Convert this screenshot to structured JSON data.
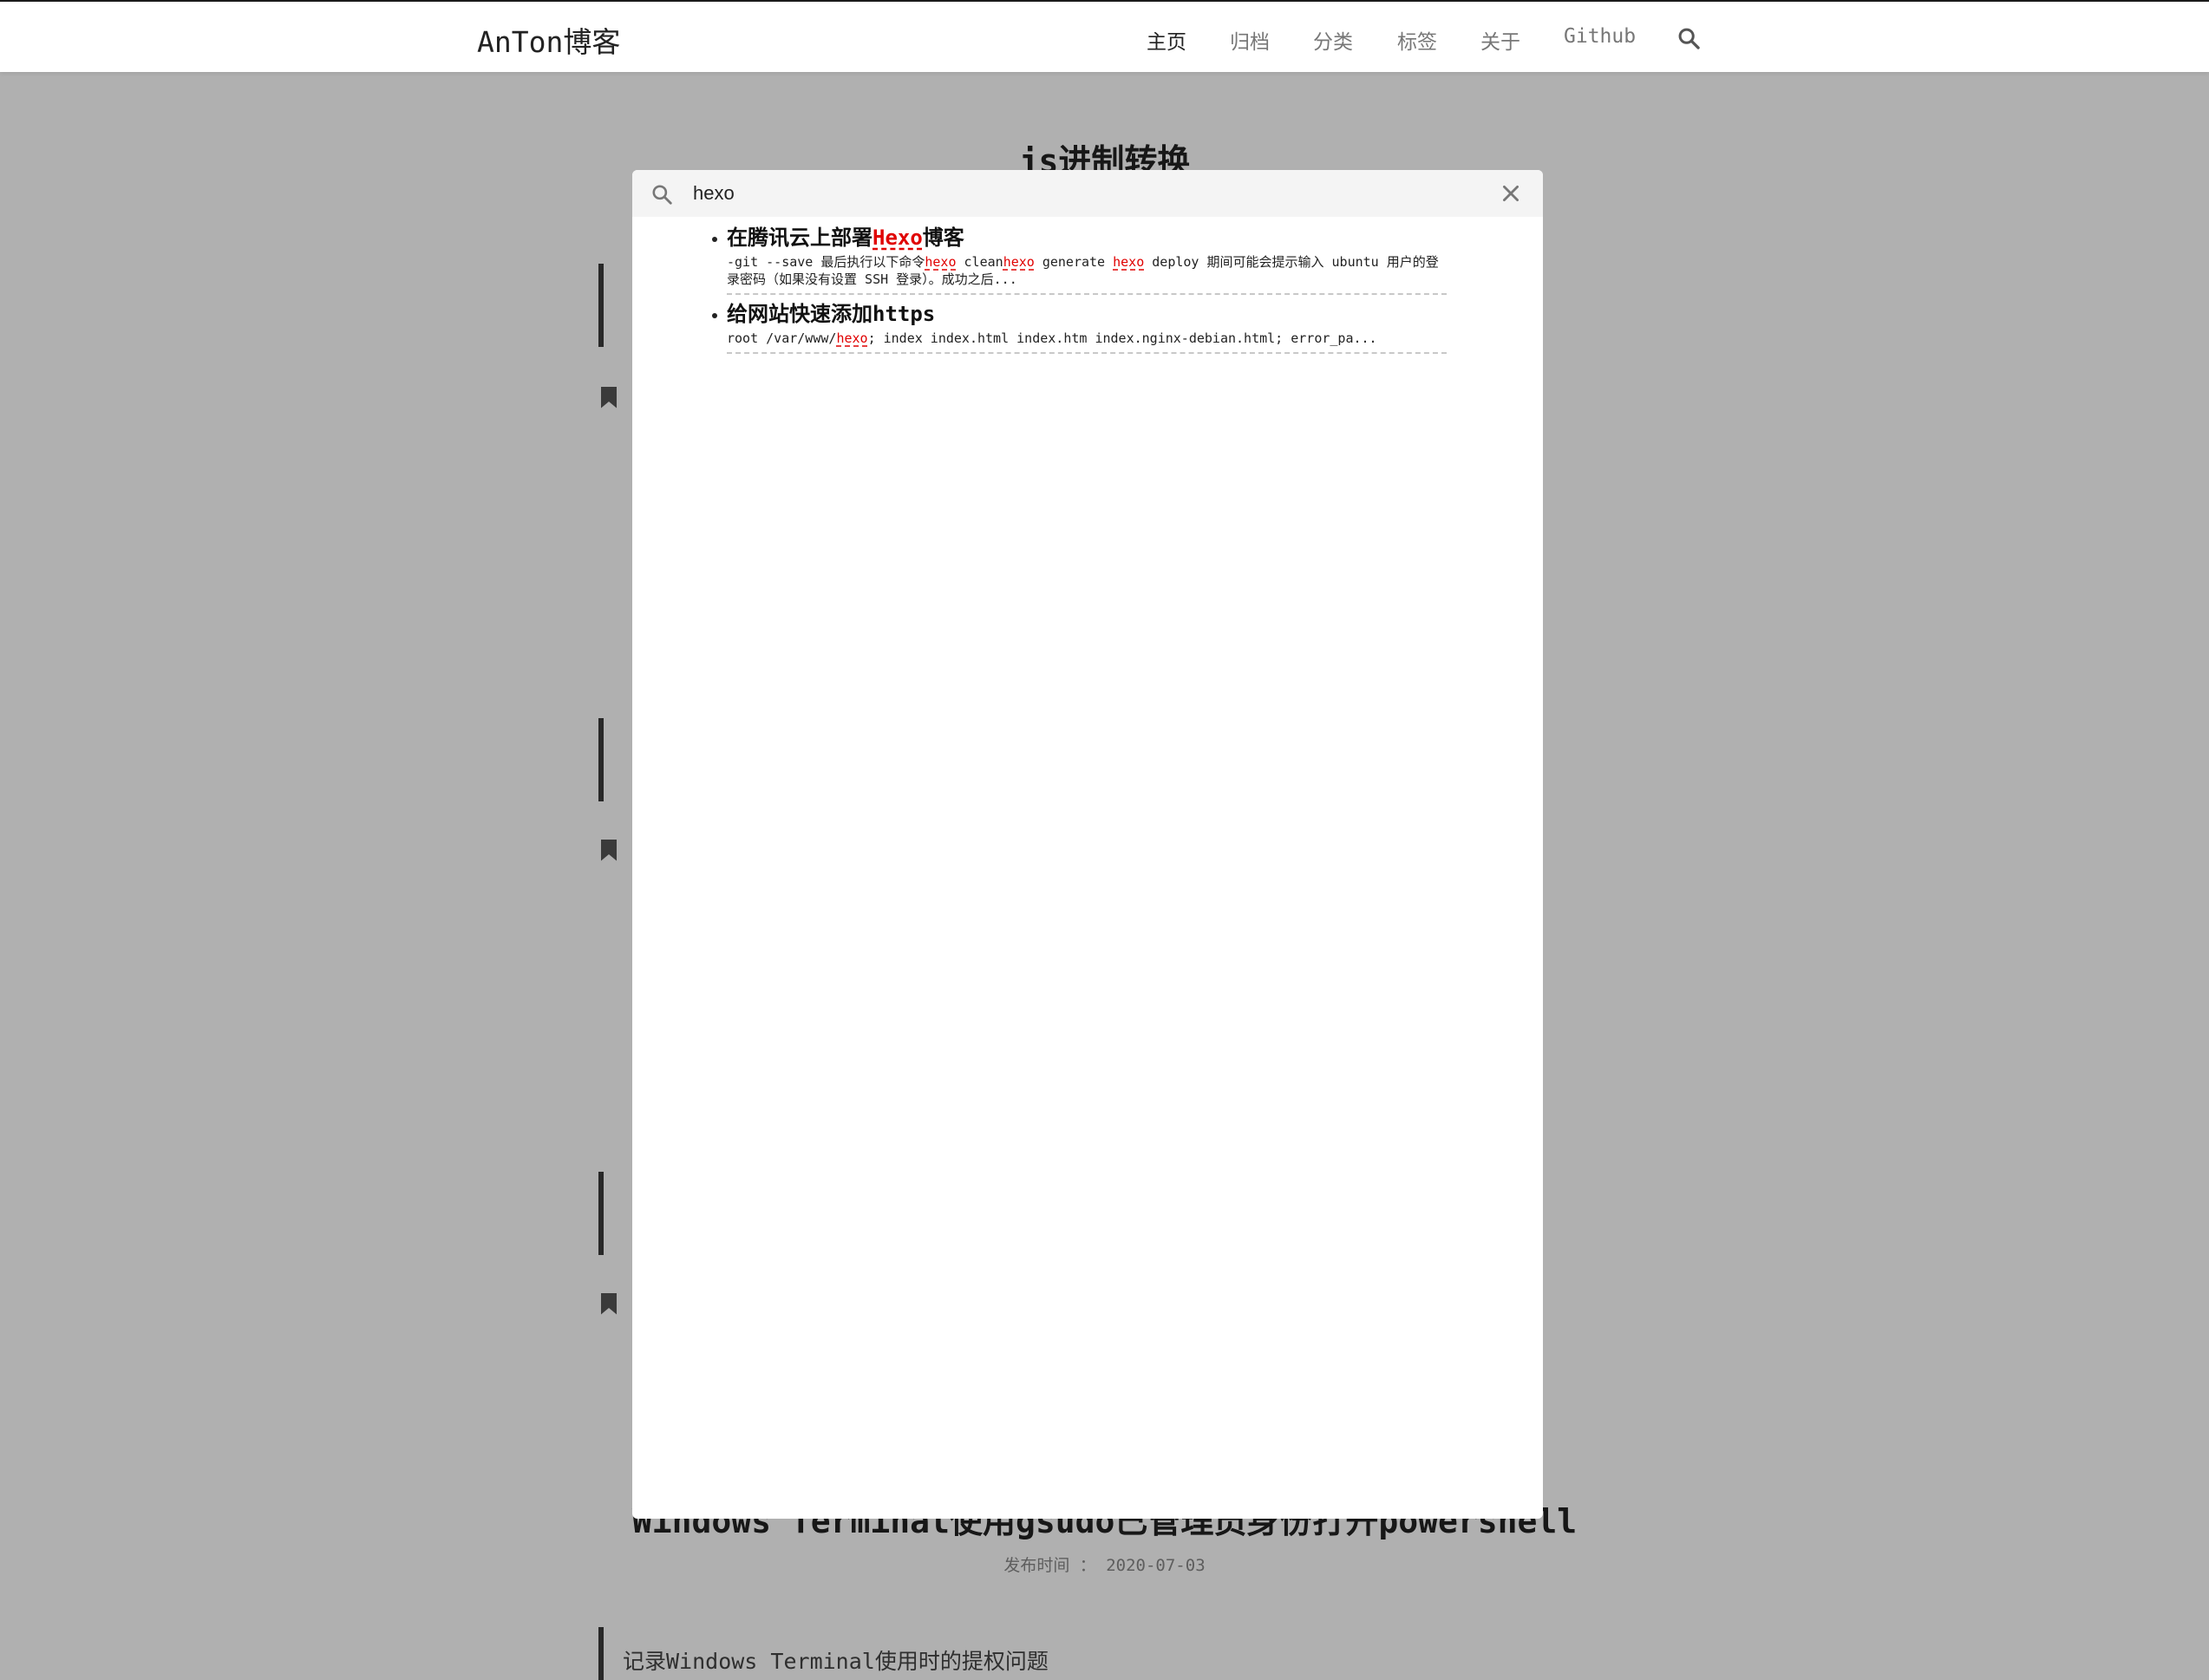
{
  "header": {
    "logo": "AnTon博客",
    "nav": [
      {
        "label": "主页",
        "active": true
      },
      {
        "label": "归档",
        "active": false
      },
      {
        "label": "分类",
        "active": false
      },
      {
        "label": "标签",
        "active": false
      },
      {
        "label": "关于",
        "active": false
      },
      {
        "label": "Github",
        "active": false
      }
    ],
    "search_icon": "search-icon"
  },
  "background": {
    "top_post_title": "js进制转换",
    "bottom_post_title": "Windows Terminal使用gsudo已管理员身份打开powershell",
    "bottom_post_date": "发布时间 ： 2020-07-03",
    "bottom_post_excerpt": "记录Windows Terminal使用时的提权问题"
  },
  "search": {
    "query": "hexo",
    "close_icon": "close-icon",
    "results": [
      {
        "title_before": "在腾讯云上部署",
        "title_highlight": "Hexo",
        "title_after": "博客",
        "snippet": [
          {
            "t": "-git --save 最后执行以下命令",
            "hl": false
          },
          {
            "t": "hexo",
            "hl": true
          },
          {
            "t": " clean",
            "hl": false
          },
          {
            "t": "hexo",
            "hl": true
          },
          {
            "t": " generate ",
            "hl": false
          },
          {
            "t": "hexo",
            "hl": true
          },
          {
            "t": " deploy 期间可能会提示输入 ubuntu 用户的登录密码（如果没有设置 SSH 登录）。成功之后...",
            "hl": false
          }
        ]
      },
      {
        "title_before": "给网站快速添加https",
        "title_highlight": "",
        "title_after": "",
        "snippet": [
          {
            "t": "root /var/www/",
            "hl": false
          },
          {
            "t": "hexo",
            "hl": true
          },
          {
            "t": "; index index.html index.htm index.nginx-debian.html; error_pa...",
            "hl": false
          }
        ]
      }
    ]
  },
  "colors": {
    "highlight": "#e00000",
    "overlay": "rgba(0,0,0,0.31)",
    "excerpt_bar": "#3a3a3a"
  }
}
